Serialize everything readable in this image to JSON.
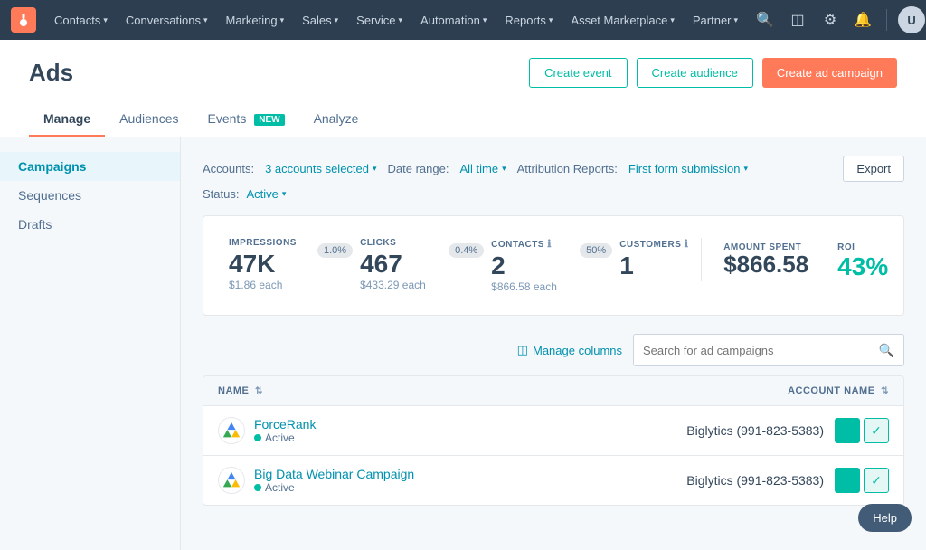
{
  "topnav": {
    "logo_label": "HubSpot",
    "items": [
      {
        "label": "Contacts",
        "id": "contacts"
      },
      {
        "label": "Conversations",
        "id": "conversations"
      },
      {
        "label": "Marketing",
        "id": "marketing"
      },
      {
        "label": "Sales",
        "id": "sales"
      },
      {
        "label": "Service",
        "id": "service"
      },
      {
        "label": "Automation",
        "id": "automation"
      },
      {
        "label": "Reports",
        "id": "reports"
      },
      {
        "label": "Asset Marketplace",
        "id": "asset-marketplace"
      },
      {
        "label": "Partner",
        "id": "partner"
      }
    ],
    "avatar_initials": "U"
  },
  "page": {
    "title": "Ads",
    "tabs": [
      {
        "label": "Manage",
        "id": "manage",
        "active": true,
        "badge": null
      },
      {
        "label": "Audiences",
        "id": "audiences",
        "active": false,
        "badge": null
      },
      {
        "label": "Events",
        "id": "events",
        "active": false,
        "badge": "NEW"
      },
      {
        "label": "Analyze",
        "id": "analyze",
        "active": false,
        "badge": null
      }
    ],
    "header_actions": {
      "create_event": "Create event",
      "create_audience": "Create audience",
      "create_campaign": "Create ad campaign"
    }
  },
  "sidebar": {
    "items": [
      {
        "label": "Campaigns",
        "id": "campaigns",
        "active": true
      },
      {
        "label": "Sequences",
        "id": "sequences",
        "active": false
      },
      {
        "label": "Drafts",
        "id": "drafts",
        "active": false
      }
    ]
  },
  "filters": {
    "accounts_label": "Accounts:",
    "accounts_value": "3 accounts selected",
    "date_range_label": "Date range:",
    "date_range_value": "All time",
    "attribution_label": "Attribution Reports:",
    "attribution_value": "First form submission",
    "status_label": "Status:",
    "status_value": "Active",
    "export_label": "Export"
  },
  "stats": {
    "impressions": {
      "label": "IMPRESSIONS",
      "value": "47K",
      "arrow": "1.0%",
      "sub": "$1.86 each"
    },
    "clicks": {
      "label": "CLICKS",
      "value": "467",
      "arrow": "0.4%",
      "sub": "$433.29 each"
    },
    "contacts": {
      "label": "CONTACTS",
      "value": "2",
      "arrow": "50%",
      "sub": "$866.58 each",
      "info": true
    },
    "customers": {
      "label": "CUSTOMERS",
      "value": "1",
      "sub": "",
      "info": true
    },
    "amount_spent": {
      "label": "AMOUNT SPENT",
      "value": "$866.58"
    },
    "roi": {
      "label": "ROI",
      "value": "43%"
    }
  },
  "table_toolbar": {
    "manage_columns": "Manage columns",
    "search_placeholder": "Search for ad campaigns"
  },
  "table": {
    "columns": [
      {
        "label": "NAME",
        "id": "name"
      },
      {
        "label": "ACCOUNT NAME",
        "id": "account_name"
      }
    ],
    "rows": [
      {
        "id": "row-1",
        "name": "ForceRank",
        "status": "Active",
        "account": "Biglytics (991-823-5383)",
        "icon_type": "google"
      },
      {
        "id": "row-2",
        "name": "Big Data Webinar Campaign",
        "status": "Active",
        "account": "Biglytics (991-823-5383)",
        "icon_type": "google"
      }
    ]
  },
  "help": {
    "label": "Help"
  }
}
